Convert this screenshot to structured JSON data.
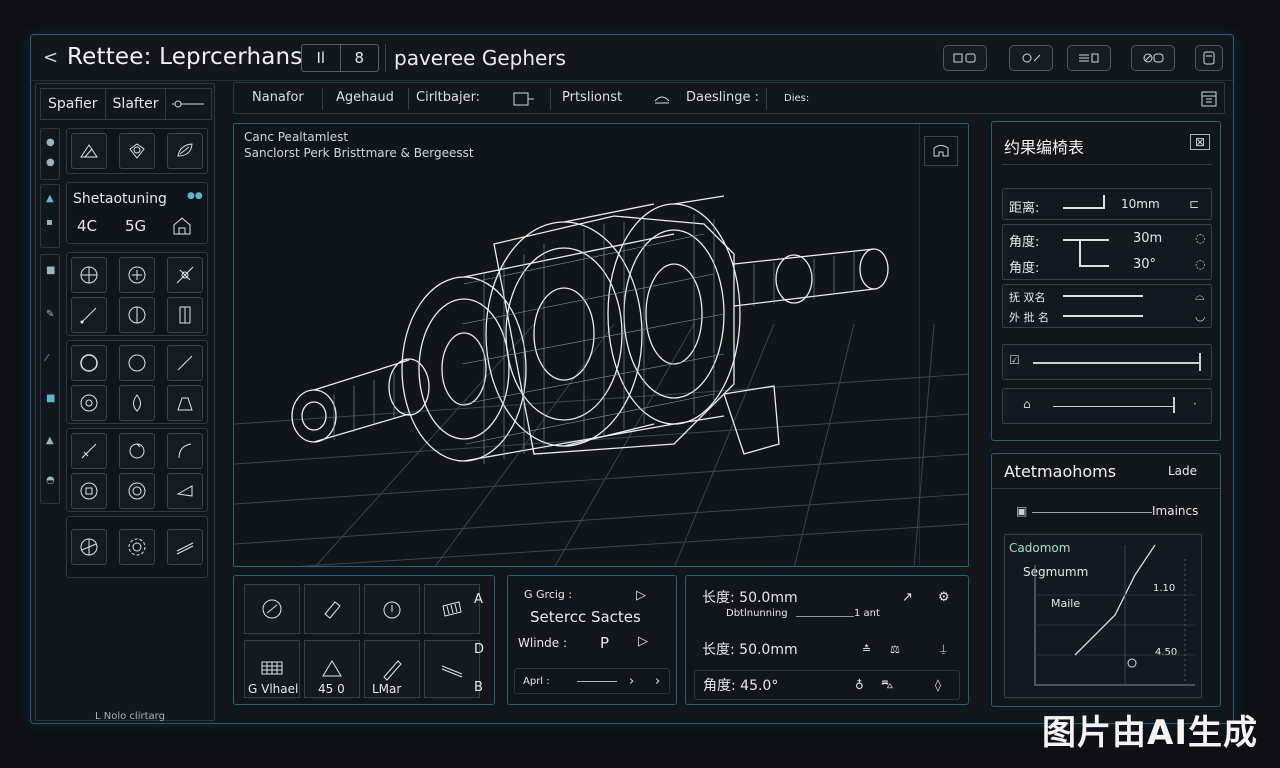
{
  "header": {
    "back_symbol": "<",
    "title": "Rettee: Leprcerhans",
    "seg_a": "Il",
    "seg_b": "8",
    "subtitle": "paveree Gephers"
  },
  "toolbar": {
    "items": [
      "Nanafor",
      "Agehaud",
      "Cirltbajer:",
      "Prtslionst",
      "Daeslinge :",
      "Dies:"
    ]
  },
  "left_panel": {
    "tabs": [
      "Spafier",
      "Slafter"
    ],
    "sketch_title": "Shetaotuning",
    "sketch_a": "4C",
    "sketch_b": "5G",
    "status": "L Nolo clirtarg"
  },
  "viewport": {
    "line1": "Canc Pealtamlest",
    "line2": "Sanclorst Perk Bristtmare & Bergeesst"
  },
  "bottom_left": {
    "letters": [
      "A",
      "D",
      "B"
    ],
    "labels": [
      "G Vlhael",
      "45 0",
      "LMar"
    ]
  },
  "bottom_mid": {
    "label1": "G Grcig :",
    "title": "Setercc Sactes",
    "label2": "Wlinde :",
    "value2": "P",
    "label3": "Aprl :"
  },
  "bottom_right": {
    "length1": "长度: 50.0mm",
    "sub": "Dbtlnunning",
    "sub_value": "1 ant",
    "length2": "长度: 50.0mm",
    "angle": "角度: 45.0°"
  },
  "constraint_panel": {
    "title": "约果编椅表",
    "distance_label": "距离:",
    "distance_value": "10mm",
    "angle1_label": "角度:",
    "angle1_value": "30m",
    "angle2_label": "角度:",
    "angle2_value": "30°",
    "extra1": "抚 双名",
    "extra2": "外 批 名"
  },
  "attr_panel": {
    "title": "Atetmaohoms",
    "side": "Lade",
    "metrics": "Imaincs",
    "graph_l1": "Cadomom",
    "graph_l2": "Segmumm",
    "graph_l3": "Maile",
    "graph_v1": "1.10",
    "graph_v2": "4.50"
  },
  "watermark": "图片由AI生成"
}
